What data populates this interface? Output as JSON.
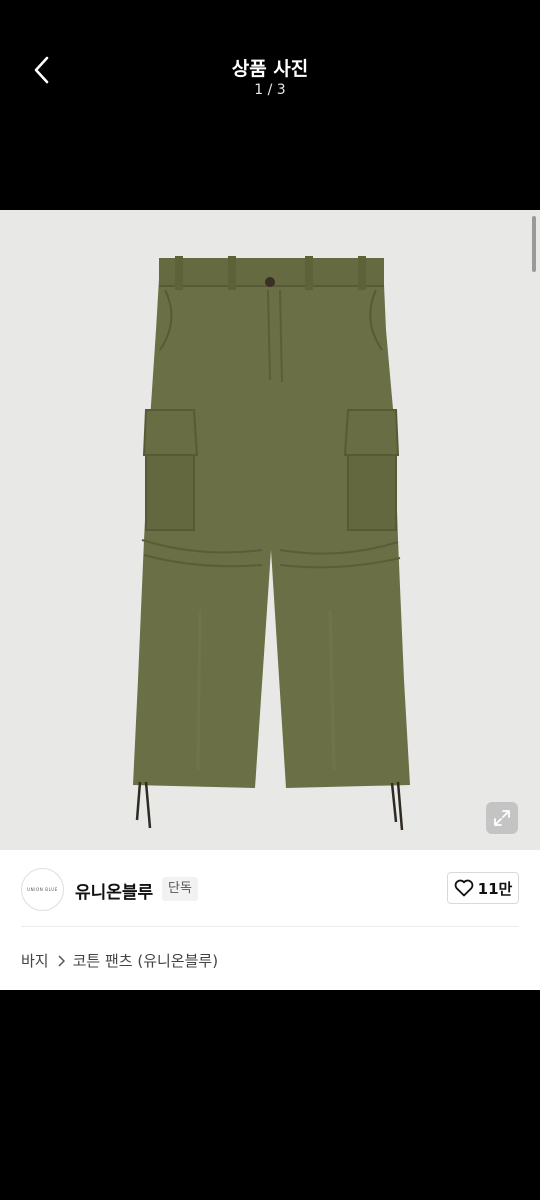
{
  "header": {
    "title": "상품 사진",
    "counter": "1 / 3"
  },
  "photo": {
    "product_color": "#6b6f45",
    "background_color": "#e8e8e6"
  },
  "brand": {
    "name": "유니온블루",
    "badge": "단독",
    "logo_text": "UNION BLUE"
  },
  "like": {
    "count": "11만"
  },
  "breadcrumb": {
    "category": "바지",
    "product": "코튼 팬츠 (유니온블루)"
  },
  "icons": {
    "back": "chevron-left-icon",
    "expand": "expand-icon",
    "like": "heart-outline-icon",
    "separator": "chevron-right-icon"
  }
}
